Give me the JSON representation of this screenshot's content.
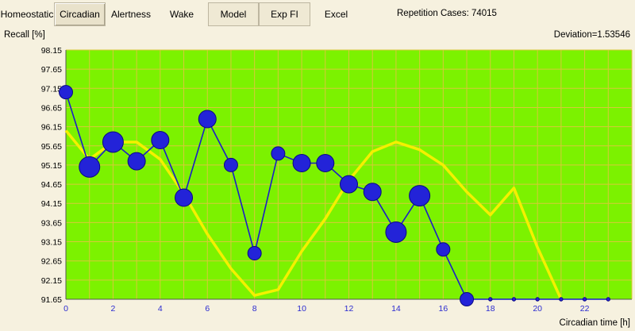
{
  "tabs": [
    {
      "id": "homeostatic",
      "label": "Homeostatic"
    },
    {
      "id": "circadian",
      "label": "Circadian"
    },
    {
      "id": "alertness",
      "label": "Alertness"
    },
    {
      "id": "wake",
      "label": "Wake"
    },
    {
      "id": "model",
      "label": "Model"
    },
    {
      "id": "exp-fi",
      "label": "Exp FI"
    },
    {
      "id": "excel",
      "label": "Excel"
    }
  ],
  "status": {
    "repetition_cases": "Repetition Cases: 74015",
    "deviation": "Deviation=1.53546"
  },
  "colors": {
    "plot_background": "#7cf200",
    "grid": "#d8c83a",
    "measured_series": "#1c1cc8",
    "measured_marker": "#2323d8",
    "model_series": "#f4f000",
    "x_tick_labels": "#2b2bd0"
  },
  "chart_data": {
    "type": "line",
    "title": "",
    "ylabel": "Recall [%]",
    "xlabel": "Circadian time [h]",
    "ylim": [
      91.65,
      98.15
    ],
    "xlim": [
      0,
      24
    ],
    "y_ticks": [
      91.65,
      92.15,
      92.65,
      93.15,
      93.65,
      94.15,
      94.65,
      95.15,
      95.65,
      96.15,
      96.65,
      97.15,
      97.65,
      98.15
    ],
    "x_ticks": [
      0,
      2,
      4,
      6,
      8,
      10,
      12,
      14,
      16,
      18,
      20,
      22
    ],
    "grid": true,
    "legend": "none",
    "series": [
      {
        "key": "measured",
        "style": "line-with-markers",
        "points": [
          {
            "x": 0,
            "y": 97.05,
            "size": "small"
          },
          {
            "x": 1,
            "y": 95.1,
            "size": "large"
          },
          {
            "x": 2,
            "y": 95.75,
            "size": "large"
          },
          {
            "x": 3,
            "y": 95.25,
            "size": "medium"
          },
          {
            "x": 4,
            "y": 95.8,
            "size": "medium"
          },
          {
            "x": 5,
            "y": 94.3,
            "size": "medium"
          },
          {
            "x": 6,
            "y": 96.35,
            "size": "medium"
          },
          {
            "x": 7,
            "y": 95.15,
            "size": "small"
          },
          {
            "x": 8,
            "y": 92.85,
            "size": "small"
          },
          {
            "x": 9,
            "y": 95.45,
            "size": "small"
          },
          {
            "x": 10,
            "y": 95.2,
            "size": "medium"
          },
          {
            "x": 11,
            "y": 95.2,
            "size": "medium"
          },
          {
            "x": 12,
            "y": 94.65,
            "size": "medium"
          },
          {
            "x": 13,
            "y": 94.45,
            "size": "medium"
          },
          {
            "x": 14,
            "y": 93.4,
            "size": "large"
          },
          {
            "x": 15,
            "y": 94.35,
            "size": "large"
          },
          {
            "x": 16,
            "y": 92.95,
            "size": "small"
          },
          {
            "x": 17,
            "y": 91.65,
            "size": "small"
          },
          {
            "x": 18,
            "y": 91.65,
            "size": "tiny"
          },
          {
            "x": 19,
            "y": 91.65,
            "size": "tiny"
          },
          {
            "x": 20,
            "y": 91.65,
            "size": "tiny"
          },
          {
            "x": 21,
            "y": 91.65,
            "size": "tiny"
          },
          {
            "x": 22,
            "y": 91.65,
            "size": "tiny"
          },
          {
            "x": 23,
            "y": 91.65,
            "size": "tiny"
          }
        ]
      },
      {
        "key": "model",
        "style": "line",
        "points": [
          {
            "x": 0,
            "y": 96.05
          },
          {
            "x": 1,
            "y": 95.3
          },
          {
            "x": 2,
            "y": 95.75
          },
          {
            "x": 3,
            "y": 95.75
          },
          {
            "x": 4,
            "y": 95.3
          },
          {
            "x": 5,
            "y": 94.4
          },
          {
            "x": 6,
            "y": 93.35
          },
          {
            "x": 7,
            "y": 92.45
          },
          {
            "x": 8,
            "y": 91.75
          },
          {
            "x": 9,
            "y": 91.9
          },
          {
            "x": 10,
            "y": 92.9
          },
          {
            "x": 11,
            "y": 93.75
          },
          {
            "x": 12,
            "y": 94.75
          },
          {
            "x": 13,
            "y": 95.5
          },
          {
            "x": 14,
            "y": 95.75
          },
          {
            "x": 15,
            "y": 95.55
          },
          {
            "x": 16,
            "y": 95.15
          },
          {
            "x": 17,
            "y": 94.45
          },
          {
            "x": 18,
            "y": 93.85
          },
          {
            "x": 19,
            "y": 94.55
          },
          {
            "x": 20,
            "y": 93.0
          },
          {
            "x": 21,
            "y": 91.65
          }
        ]
      }
    ]
  }
}
